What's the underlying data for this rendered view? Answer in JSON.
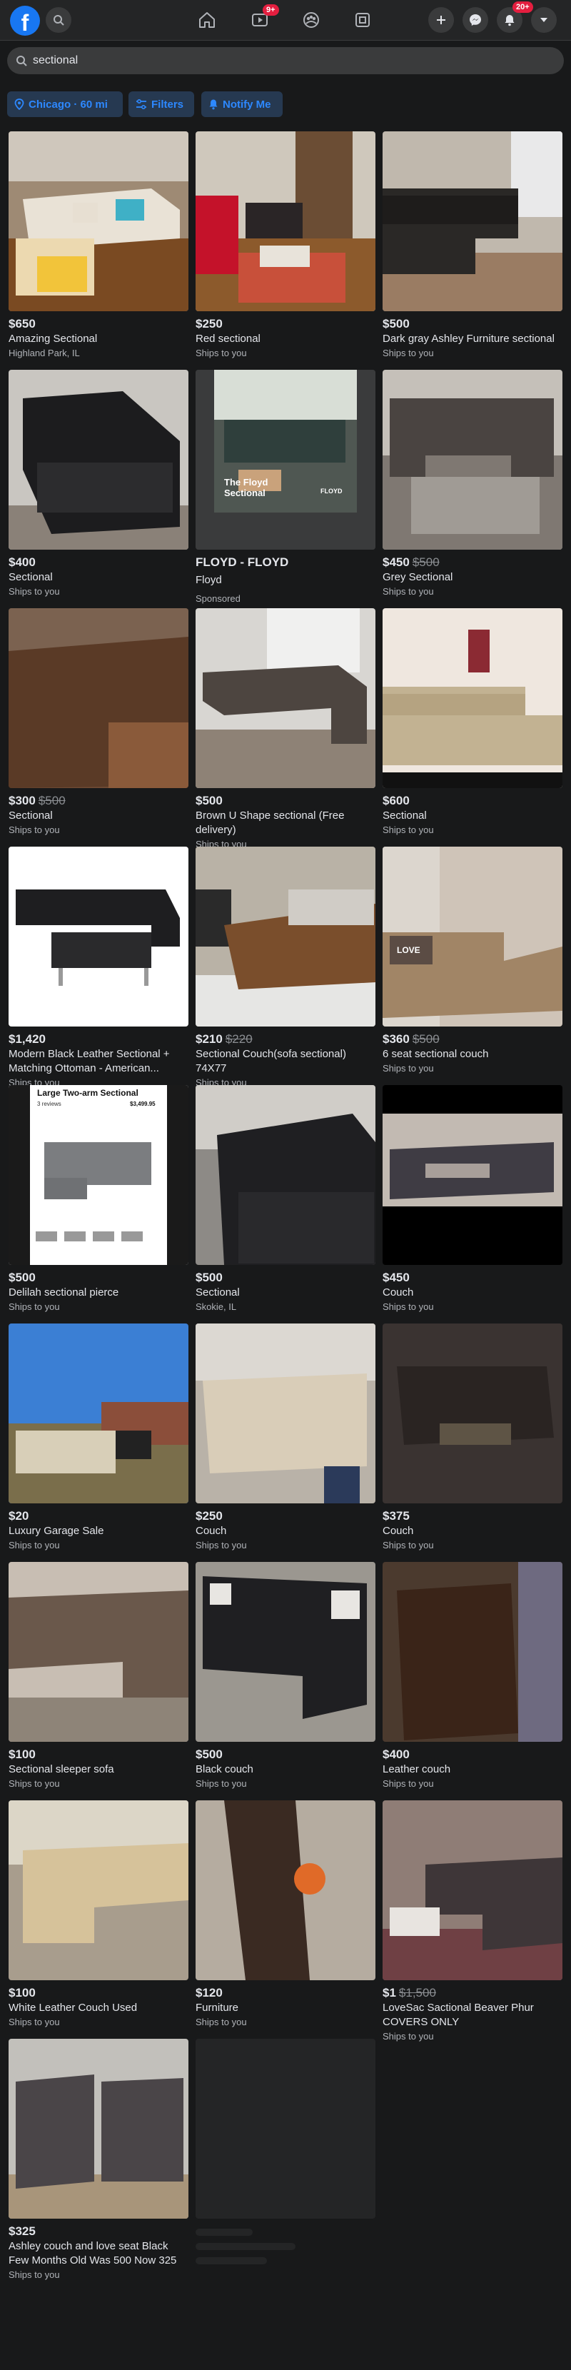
{
  "nav": {
    "logo": "f",
    "video_badge": "9+",
    "notif_badge": "20+"
  },
  "search": {
    "query": "sectional"
  },
  "filters": {
    "location": "Chicago · 60 mi",
    "filters": "Filters",
    "notify": "Notify Me"
  },
  "colors": {
    "accent": "#2d88ff",
    "background": "#18191a",
    "badge": "#e41e3f"
  },
  "listings": [
    {
      "price": "$650",
      "title": "Amazing Sectional",
      "location": "Highland Park, IL"
    },
    {
      "price": "$250",
      "title": "Red sectional",
      "location": "Ships to you"
    },
    {
      "price": "$500",
      "title": "Dark gray Ashley Furniture sectional",
      "location": "Ships to you"
    },
    {
      "price": "$400",
      "title": "Sectional",
      "location": "Ships to you"
    },
    {
      "ad": true,
      "title": "FLOYD - FLOYD",
      "subtitle": "Floyd",
      "sponsored": "Sponsored",
      "image_text": "The Floyd Sectional",
      "image_brand": "FLOYD"
    },
    {
      "price": "$450",
      "old_price": "$500",
      "title": "Grey Sectional",
      "location": "Ships to you"
    },
    {
      "price": "$300",
      "old_price": "$500",
      "title": "Sectional",
      "location": "Ships to you"
    },
    {
      "price": "$500",
      "title": "Brown U Shape sectional (Free delivery)",
      "location": "Ships to you"
    },
    {
      "price": "$600",
      "title": "Sectional",
      "location": "Ships to you"
    },
    {
      "price": "$1,420",
      "title": "Modern Black Leather Sectional + Matching Ottoman - American...",
      "location": "Ships to you"
    },
    {
      "price": "$210",
      "old_price": "$220",
      "title": "Sectional Couch(sofa sectional) 74X77",
      "location": "Ships to you"
    },
    {
      "price": "$360",
      "old_price": "$500",
      "title": "6 seat sectional couch",
      "location": "Ships to you",
      "image_text": "LOVE"
    },
    {
      "price": "$500",
      "title": "Delilah sectional pierce",
      "location": "Ships to you",
      "image_text": "Large Two-arm Sectional",
      "image_reviews": "3 reviews",
      "image_price": "$3,499.95"
    },
    {
      "price": "$500",
      "title": "Sectional",
      "location": "Skokie, IL"
    },
    {
      "price": "$450",
      "title": "Couch",
      "location": "Ships to you"
    },
    {
      "price": "$20",
      "title": "Luxury Garage Sale",
      "location": "Ships to you"
    },
    {
      "price": "$250",
      "title": "Couch",
      "location": "Ships to you"
    },
    {
      "price": "$375",
      "title": "Couch",
      "location": "Ships to you"
    },
    {
      "price": "$100",
      "title": "Sectional sleeper sofa",
      "location": "Ships to you"
    },
    {
      "price": "$500",
      "title": "Black couch",
      "location": "Ships to you"
    },
    {
      "price": "$400",
      "title": "Leather couch",
      "location": "Ships to you"
    },
    {
      "price": "$100",
      "title": "White Leather Couch Used",
      "location": "Ships to you"
    },
    {
      "price": "$120",
      "title": "Furniture",
      "location": "Ships to you"
    },
    {
      "price": "$1",
      "old_price": "$1,500",
      "title": "LoveSac Sactional Beaver Phur COVERS ONLY",
      "location": "Ships to you"
    },
    {
      "price": "$325",
      "title": "Ashley couch and love seat Black Few Months Old Was 500 Now 325",
      "location": "Ships to you"
    }
  ]
}
